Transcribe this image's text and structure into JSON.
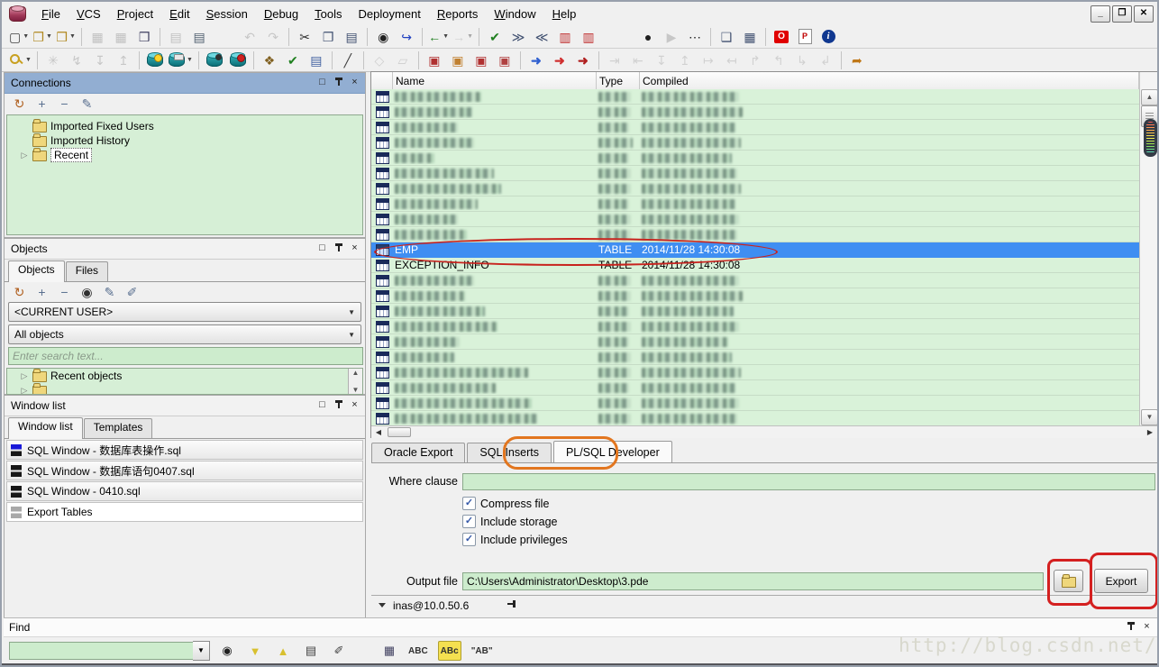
{
  "window": {
    "controls": {
      "minimize": "_",
      "restore": "❐",
      "close": "✕"
    }
  },
  "menu_bar": {
    "items": [
      {
        "label": "File",
        "u": 0
      },
      {
        "label": "VCS",
        "u": 0
      },
      {
        "label": "Project",
        "u": 0
      },
      {
        "label": "Edit",
        "u": 0
      },
      {
        "label": "Session",
        "u": 0
      },
      {
        "label": "Debug",
        "u": 0
      },
      {
        "label": "Tools",
        "u": 0
      },
      {
        "label": "Deployment",
        "u": -1
      },
      {
        "label": "Reports",
        "u": 0
      },
      {
        "label": "Window",
        "u": 0
      },
      {
        "label": "Help",
        "u": 0
      }
    ]
  },
  "toolbars": {
    "row1": [
      {
        "n": "new-icon",
        "g": "▢",
        "c": "#404040",
        "dd": true
      },
      {
        "n": "open-icon",
        "g": "❐",
        "c": "#b08820",
        "dd": true
      },
      {
        "n": "open-recent-icon",
        "g": "❒",
        "c": "#b08820",
        "dd": true
      },
      {
        "sep": true
      },
      {
        "n": "save-icon",
        "g": "▦",
        "c": "#808080",
        "dis": true
      },
      {
        "n": "save-as-icon",
        "g": "▦",
        "c": "#808080",
        "dis": true
      },
      {
        "n": "save-all-icon",
        "g": "❒",
        "c": "#404060"
      },
      {
        "sep": true
      },
      {
        "n": "print-icon",
        "g": "▤",
        "c": "#808080",
        "dis": true
      },
      {
        "n": "print-setup-icon",
        "g": "▤",
        "c": "#506070"
      },
      {
        "gap": 30
      },
      {
        "n": "undo-icon",
        "g": "↶",
        "c": "#909090",
        "dis": true
      },
      {
        "n": "redo-icon",
        "g": "↷",
        "c": "#909090",
        "dis": true
      },
      {
        "sep": true
      },
      {
        "n": "cut-icon",
        "g": "✂",
        "c": "#303030"
      },
      {
        "n": "copy-icon",
        "g": "❐",
        "c": "#405070"
      },
      {
        "n": "paste-icon",
        "g": "▤",
        "c": "#405070"
      },
      {
        "sep": true
      },
      {
        "n": "find-icon",
        "g": "◉",
        "c": "#202020"
      },
      {
        "n": "find-next-icon",
        "g": "↪",
        "c": "#2040c0"
      },
      {
        "sep": true
      },
      {
        "n": "back-icon",
        "g": "←",
        "c": "#208020",
        "dd": true,
        "cls": "arr"
      },
      {
        "n": "forward-icon",
        "g": "→",
        "c": "#a8a8a8",
        "dd": true,
        "dis": true,
        "cls": "arr"
      },
      {
        "sep": true
      },
      {
        "n": "syntax-check-icon",
        "g": "✔",
        "c": "#208020"
      },
      {
        "n": "indent-icon",
        "g": "≫",
        "c": "#405070"
      },
      {
        "n": "unindent-icon",
        "g": "≪",
        "c": "#405070"
      },
      {
        "n": "add-record-icon",
        "g": "▥",
        "c": "#c03030"
      },
      {
        "n": "delete-record-icon",
        "g": "▥",
        "c": "#c03030"
      },
      {
        "gap": 40
      },
      {
        "n": "macro-record-icon",
        "g": "●",
        "c": "#202020"
      },
      {
        "n": "macro-play-icon",
        "g": "▶",
        "c": "#909090",
        "dis": true
      },
      {
        "n": "macro-library-icon",
        "g": "⋯",
        "c": "#202020"
      },
      {
        "sep": true
      },
      {
        "n": "cascade-windows-icon",
        "g": "❑",
        "c": "#405070"
      },
      {
        "n": "tile-windows-icon",
        "g": "▦",
        "c": "#405070"
      },
      {
        "sep": true
      },
      {
        "n": "oracle-home-icon",
        "cls2": "oraico",
        "g": "O"
      },
      {
        "n": "pdf-export-icon",
        "cls2": "pdfico",
        "g": "P"
      },
      {
        "n": "info-icon",
        "cls2": "infoico",
        "g": "i"
      }
    ],
    "row2": [
      {
        "n": "connect-icon",
        "cls2": "keyico",
        "g": "",
        "dd": true
      },
      {
        "sep": true
      },
      {
        "n": "session-icon",
        "g": "✳",
        "c": "#909090",
        "dis": true
      },
      {
        "n": "commit-icon",
        "g": "↯",
        "c": "#909090",
        "dis": true
      },
      {
        "n": "import-icon",
        "g": "↧",
        "c": "#909090",
        "dis": true
      },
      {
        "n": "export-icon",
        "g": "↥",
        "c": "#909090",
        "dis": true
      },
      {
        "sep": true
      },
      {
        "n": "new-sql-window-icon",
        "cls2": "dbico",
        "badge": "lamp"
      },
      {
        "n": "command-window-icon",
        "cls2": "dbico",
        "badge": "sql",
        "dd": true
      },
      {
        "sep": true
      },
      {
        "n": "find-database-object-icon",
        "cls2": "dbico",
        "badge": "find"
      },
      {
        "n": "kill-session-icon",
        "cls2": "dbico",
        "badge": "stop"
      },
      {
        "sep": true
      },
      {
        "n": "browser-keys-icon",
        "g": "❖",
        "c": "#806020"
      },
      {
        "n": "test-window-icon",
        "g": "✔",
        "c": "#208020"
      },
      {
        "n": "report-window-icon",
        "g": "▤",
        "c": "#4060a0"
      },
      {
        "sep": true
      },
      {
        "n": "preferences-wrench-icon",
        "g": "╱",
        "c": "#404040"
      },
      {
        "sep": true
      },
      {
        "n": "new-item-icon",
        "g": "◇",
        "c": "#a0a0a0",
        "dis": true
      },
      {
        "n": "eraser-icon",
        "g": "▱",
        "c": "#a0a0a0",
        "dis": true
      },
      {
        "sep": true
      },
      {
        "n": "compile-icon",
        "g": "▣",
        "c": "#b03030"
      },
      {
        "n": "compile-with-debug-icon",
        "g": "▣",
        "c": "#c08030"
      },
      {
        "n": "execute-doc-icon",
        "g": "▣",
        "c": "#b03030"
      },
      {
        "n": "execute-script-icon",
        "g": "▣",
        "c": "#b04040"
      },
      {
        "sep": true
      },
      {
        "n": "run-icon",
        "g": "➜",
        "c": "#3060d0",
        "cls": "arr"
      },
      {
        "n": "resume-icon",
        "g": "➜",
        "c": "#d03030",
        "cls": "arr"
      },
      {
        "n": "run-exception-icon",
        "g": "➜",
        "c": "#b02020",
        "cls": "arr"
      },
      {
        "sep": true
      },
      {
        "n": "step-into-icon",
        "g": "⇥",
        "c": "#a8a8a8",
        "dis": true
      },
      {
        "n": "step-over-icon",
        "g": "⇤",
        "c": "#a8a8a8",
        "dis": true
      },
      {
        "n": "step-out-icon",
        "g": "↧",
        "c": "#a8a8a8",
        "dis": true
      },
      {
        "n": "run-to-cursor-icon",
        "g": "↥",
        "c": "#a8a8a8",
        "dis": true
      },
      {
        "n": "breakpoint-icon",
        "g": "↦",
        "c": "#a8a8a8",
        "dis": true
      },
      {
        "n": "toggle-breakpoint-icon",
        "g": "↤",
        "c": "#a8a8a8",
        "dis": true
      },
      {
        "n": "watch-icon",
        "g": "↱",
        "c": "#a8a8a8",
        "dis": true
      },
      {
        "n": "call-stack-icon",
        "g": "↰",
        "c": "#a8a8a8",
        "dis": true
      },
      {
        "n": "stop-debug-icon",
        "g": "↳",
        "c": "#a8a8a8",
        "dis": true
      },
      {
        "n": "abort-icon",
        "g": "↲",
        "c": "#a8a8a8",
        "dis": true
      },
      {
        "sep": true
      },
      {
        "n": "break-session-icon",
        "g": "➦",
        "c": "#c07818"
      }
    ]
  },
  "panels": {
    "connections": {
      "title": "Connections",
      "toolbar": [
        {
          "n": "refresh-connections-icon",
          "g": "↻",
          "c": "#b06020"
        },
        {
          "n": "add-connection-icon",
          "g": "+",
          "c": "#5a7090"
        },
        {
          "n": "remove-connection-icon",
          "g": "−",
          "c": "#5a7090"
        },
        {
          "n": "edit-connections-icon",
          "g": "✎",
          "c": "#5a7090"
        }
      ],
      "tree": [
        {
          "label": "Imported Fixed Users"
        },
        {
          "label": "Imported History"
        },
        {
          "label": "Recent",
          "expander": true,
          "selected": true
        }
      ]
    },
    "objects": {
      "title": "Objects",
      "tabs": [
        {
          "label": "Objects",
          "active": true
        },
        {
          "label": "Files"
        }
      ],
      "toolbar": [
        {
          "n": "refresh-objects-icon",
          "g": "↻",
          "c": "#b06020"
        },
        {
          "n": "add-object-icon",
          "g": "+",
          "c": "#5a7090"
        },
        {
          "n": "remove-object-icon",
          "g": "−",
          "c": "#5a7090"
        },
        {
          "n": "find-object-icon",
          "g": "◉",
          "c": "#303030"
        },
        {
          "n": "filter-objects-icon",
          "g": "✎",
          "c": "#5a7090"
        },
        {
          "n": "filter-settings-icon",
          "g": "✐",
          "c": "#5a7090"
        }
      ],
      "user_filter": "<CURRENT USER>",
      "object_filter": "All objects",
      "search_placeholder": "Enter search text...",
      "tree": [
        {
          "label": "Recent objects",
          "expander": true
        },
        {
          "label": "",
          "expander": true
        }
      ]
    },
    "window_list": {
      "title": "Window list",
      "tabs": [
        {
          "label": "Window list",
          "active": true
        },
        {
          "label": "Templates"
        }
      ],
      "items": [
        {
          "label": "SQL Window - 数据库表操作.sql",
          "icon": "sql-window-icon",
          "c1": "#1818d8",
          "c2": "#181818"
        },
        {
          "label": "SQL Window - 数据库语句0407.sql",
          "icon": "sql-window-icon",
          "c1": "#181818",
          "c2": "#181818"
        },
        {
          "label": "SQL Window - 0410.sql",
          "icon": "sql-window-icon",
          "c1": "#181818",
          "c2": "#181818"
        },
        {
          "label": "Export Tables",
          "icon": "export-tables-window-icon",
          "c1": "#a8a8a8",
          "c2": "#a8a8a8",
          "plain": true
        }
      ]
    }
  },
  "object_list": {
    "columns": [
      "Name",
      "Type",
      "Compiled"
    ],
    "rows": [
      {
        "cz": true,
        "nw": 96,
        "tw": 36,
        "cw": 108
      },
      {
        "cz": true,
        "nw": 86,
        "tw": 36,
        "cw": 112
      },
      {
        "cz": true,
        "nw": 70,
        "tw": 34,
        "cw": 104
      },
      {
        "cz": true,
        "nw": 88,
        "tw": 38,
        "cw": 110
      },
      {
        "cz": true,
        "nw": 44,
        "tw": 34,
        "cw": 100
      },
      {
        "cz": true,
        "nw": 110,
        "tw": 36,
        "cw": 106
      },
      {
        "cz": true,
        "nw": 118,
        "tw": 36,
        "cw": 110
      },
      {
        "cz": true,
        "nw": 92,
        "tw": 34,
        "cw": 104
      },
      {
        "cz": true,
        "nw": 70,
        "tw": 36,
        "cw": 108
      },
      {
        "cz": true,
        "nw": 80,
        "tw": 36,
        "cw": 106
      },
      {
        "name": "EMP",
        "type": "TABLE",
        "compiled": "2014/11/28 14:30:08",
        "sel": true
      },
      {
        "name": "EXCEPTION_INFO",
        "type": "TABLE",
        "compiled": "2014/11/28 14:30:08"
      },
      {
        "cz": true,
        "nw": 88,
        "tw": 36,
        "cw": 108
      },
      {
        "cz": true,
        "nw": 78,
        "tw": 36,
        "cw": 112
      },
      {
        "cz": true,
        "nw": 100,
        "tw": 34,
        "cw": 102
      },
      {
        "cz": true,
        "nw": 114,
        "tw": 36,
        "cw": 108
      },
      {
        "cz": true,
        "nw": 72,
        "tw": 34,
        "cw": 96
      },
      {
        "cz": true,
        "nw": 66,
        "tw": 36,
        "cw": 100
      },
      {
        "cz": true,
        "nw": 148,
        "tw": 36,
        "cw": 110
      },
      {
        "cz": true,
        "nw": 112,
        "tw": 34,
        "cw": 104
      },
      {
        "cz": true,
        "nw": 152,
        "tw": 36,
        "cw": 108
      },
      {
        "cz": true,
        "nw": 158,
        "tw": 36,
        "cw": 106
      }
    ]
  },
  "export_panel": {
    "tabs": [
      {
        "label": "Oracle Export"
      },
      {
        "label": "SQL Inserts"
      },
      {
        "label": "PL/SQL Developer",
        "active": true,
        "annotated": true
      }
    ],
    "where_label": "Where clause",
    "where_value": "",
    "checkboxes": [
      {
        "label": "Compress file",
        "checked": true
      },
      {
        "label": "Include storage",
        "checked": true
      },
      {
        "label": "Include privileges",
        "checked": true
      }
    ],
    "output_label": "Output file",
    "output_value": "C:\\Users\\Administrator\\Desktop\\3.pde",
    "export_button": "Export"
  },
  "status_bar": {
    "connection": "inas@10.0.50.6"
  },
  "find_panel": {
    "title": "Find",
    "icons": [
      {
        "n": "find-binoculars-icon",
        "g": "◉",
        "c": "#202020"
      },
      {
        "n": "find-next-down-icon",
        "g": "▼",
        "c": "#d8c030"
      },
      {
        "n": "find-previous-up-icon",
        "g": "▲",
        "c": "#d8c030"
      },
      {
        "n": "highlight-all-icon",
        "g": "▤",
        "c": "#404040"
      },
      {
        "n": "clear-highlight-icon",
        "g": "✐",
        "c": "#404040"
      },
      {
        "gap": 14
      },
      {
        "n": "find-options-icon",
        "g": "▦",
        "c": "#404060"
      },
      {
        "n": "case-sensitive-icon",
        "g": "ABC",
        "txt": true,
        "c": "#303030"
      },
      {
        "n": "whole-word-icon",
        "g": "ABc",
        "txt": true,
        "hl": true,
        "c": "#303030"
      },
      {
        "n": "exact-phrase-icon",
        "g": "\"AB\"",
        "txt": true,
        "c": "#303030"
      }
    ]
  },
  "watermark": "http://blog.csdn.net/Cow_cz",
  "colors": {
    "selection": "#3f8ef2",
    "panel_green": "#d6efd6",
    "annotation_red": "#c8231e",
    "annotation_orange": "#e2761f",
    "header_blue": "#92aed2"
  }
}
